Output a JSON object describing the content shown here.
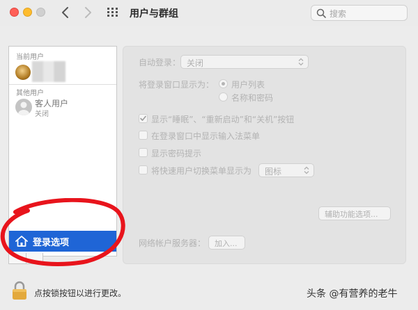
{
  "window": {
    "title": "用户与群组",
    "search_placeholder": "搜索"
  },
  "sidebar": {
    "current_users_label": "当前用户",
    "other_users_label": "其他用户",
    "guest": {
      "name": "客人用户",
      "status": "关闭"
    },
    "login_options_label": "登录选项"
  },
  "panel": {
    "auto_login": {
      "label": "自动登录：",
      "value": "关闭"
    },
    "display_login_window_as": {
      "label": "将登录窗口显示为：",
      "options": [
        "用户列表",
        "名称和密码"
      ],
      "selected": "用户列表"
    },
    "checkboxes": [
      {
        "label": "显示“睡眠”、“重新启动”和“关机”按钮",
        "checked": true
      },
      {
        "label": "在登录窗口中显示输入法菜单",
        "checked": false
      },
      {
        "label": "显示密码提示",
        "checked": false
      },
      {
        "label": "将快速用户切换菜单显示为",
        "checked": false
      }
    ],
    "fast_switch_style": "图标",
    "accessibility_button": "辅助功能选项...",
    "network_server": {
      "label": "网络帐户服务器：",
      "join_button": "加入..."
    }
  },
  "footer": {
    "lock_text": "点按锁按钮以进行更改。"
  },
  "watermark": "头条 @有营养的老牛",
  "colors": {
    "selection_blue": "#1f65d6",
    "annotation_red": "#e8141c",
    "close": "#ff5f57",
    "minimize": "#febc2e"
  }
}
